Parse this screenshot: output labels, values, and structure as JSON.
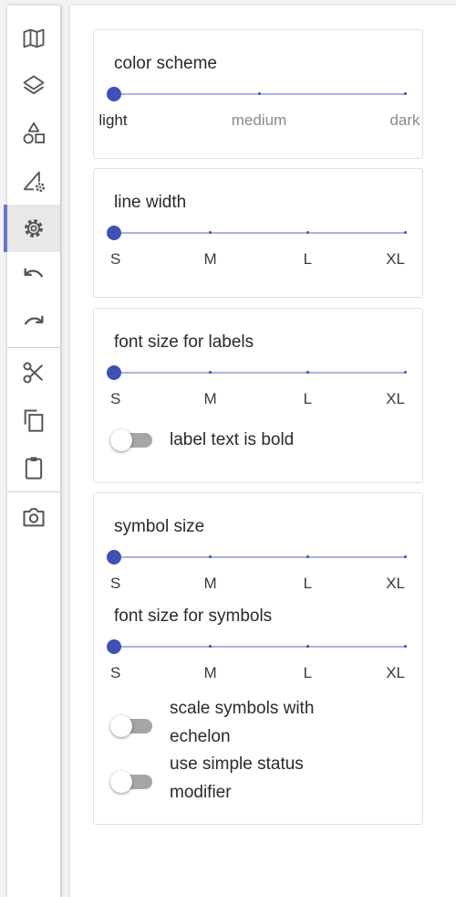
{
  "colors": {
    "accent": "#3f51b5",
    "track": "#aab3dd",
    "active_indicator": "#6677cc",
    "toggle_off": "#a6a6a6"
  },
  "toolbar": {
    "items": [
      {
        "icon": "map-icon"
      },
      {
        "icon": "layers-icon"
      },
      {
        "icon": "shapes-icon"
      },
      {
        "icon": "geometry-settings-icon"
      },
      {
        "icon": "gear-icon",
        "active": true
      },
      {
        "icon": "undo-icon"
      },
      {
        "icon": "redo-icon"
      },
      {
        "icon": "scissors-icon"
      },
      {
        "icon": "copy-icon"
      },
      {
        "icon": "clipboard-icon"
      },
      {
        "icon": "camera-icon"
      }
    ]
  },
  "color_scheme": {
    "title": "color scheme",
    "labels": [
      "light",
      "medium",
      "dark"
    ],
    "value": "light"
  },
  "line_width": {
    "title": "line width",
    "labels": [
      "S",
      "M",
      "L",
      "XL"
    ],
    "value": "S"
  },
  "label_font": {
    "title": "font size for labels",
    "labels": [
      "S",
      "M",
      "L",
      "XL"
    ],
    "value": "S",
    "bold_toggle": {
      "label": "label text is bold",
      "checked": false
    }
  },
  "symbols": {
    "size_title": "symbol size",
    "size_labels": [
      "S",
      "M",
      "L",
      "XL"
    ],
    "size_value": "S",
    "font_title": "font size for symbols",
    "font_labels": [
      "S",
      "M",
      "L",
      "XL"
    ],
    "font_value": "S",
    "scale_toggle": {
      "label_line1": "scale symbols with",
      "label_line2": "echelon",
      "checked": false
    },
    "status_toggle": {
      "label_line1": "use simple status",
      "label_line2": "modifier",
      "checked": false
    }
  }
}
